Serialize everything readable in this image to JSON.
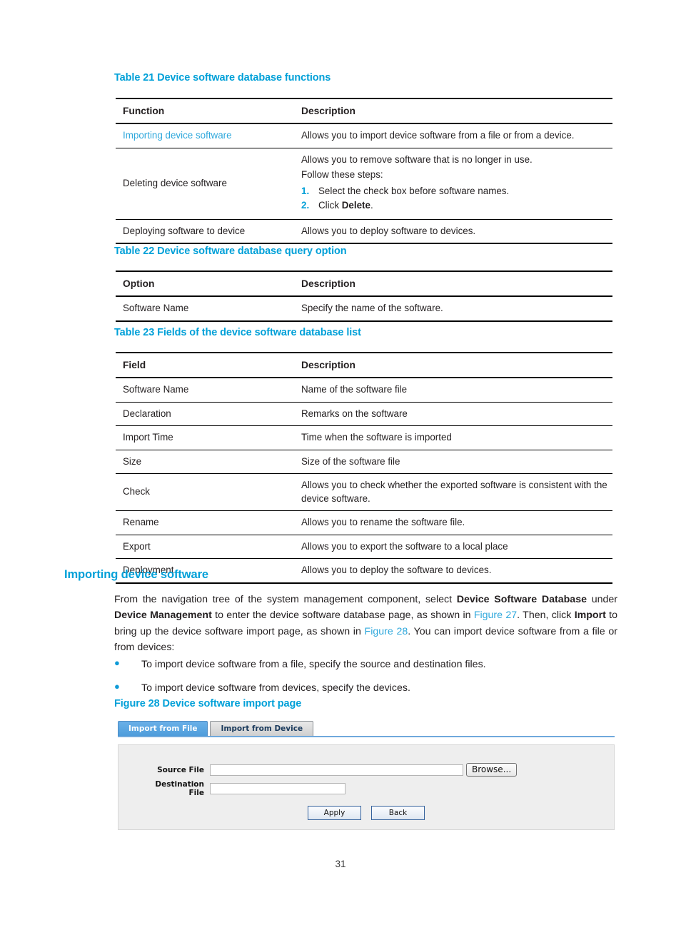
{
  "tables": [
    {
      "caption": "Table 21 Device software database functions",
      "headers": [
        "Function",
        "Description"
      ],
      "rows": [
        {
          "cell_a": "Importing device software",
          "cell_a_style": "link",
          "cell_b": "Allows you to import device software from a file or from a device."
        },
        {
          "cell_a": "Deleting device software",
          "cell_b_intro": "Allows you to remove software that is no longer in use.",
          "cell_b_steps_label": "Follow these steps:",
          "steps": [
            {
              "num": "1.",
              "text": "Select the check box before software names."
            },
            {
              "num": "2.",
              "text_pre": "Click ",
              "text_bold": "Delete",
              "text_post": "."
            }
          ]
        },
        {
          "cell_a": "Deploying software to device",
          "cell_b": "Allows you to deploy software to devices."
        }
      ]
    },
    {
      "caption": "Table 22 Device software database query option",
      "headers": [
        "Option",
        "Description"
      ],
      "rows": [
        {
          "cell_a": "Software Name",
          "cell_b": "Specify the name of the software."
        }
      ]
    },
    {
      "caption": "Table 23 Fields of the device software database list",
      "headers": [
        "Field",
        "Description"
      ],
      "rows": [
        {
          "cell_a": "Software Name",
          "cell_b": "Name of the software file"
        },
        {
          "cell_a": "Declaration",
          "cell_b": "Remarks on the software"
        },
        {
          "cell_a": "Import Time",
          "cell_b": "Time when the software is imported"
        },
        {
          "cell_a": "Size",
          "cell_b": "Size of the software file"
        },
        {
          "cell_a": "Check",
          "cell_b": "Allows you to check whether the exported software is consistent with the device software."
        },
        {
          "cell_a": "Rename",
          "cell_b": "Allows you to rename the software file."
        },
        {
          "cell_a": "Export",
          "cell_b": "Allows you to export the software to a local place"
        },
        {
          "cell_a": "Deployment",
          "cell_b": "Allows you to deploy the software to devices."
        }
      ]
    }
  ],
  "section": {
    "heading": "Importing device software",
    "paragraph": {
      "p1": "From the navigation tree of the system management component, select ",
      "b1": "Device Software Database",
      "p2": " under ",
      "b2": "Device Management",
      "p3": " to enter the device software database page, as shown in ",
      "ref1": "Figure 27",
      "p4": ". Then, click ",
      "b3": "Import",
      "p5": " to bring up the device software import page, as shown in ",
      "ref2": "Figure 28",
      "p6": ". You can import device software from a file or from devices:"
    },
    "bullets": [
      "To import device software from a file, specify the source and destination files.",
      "To import device software from devices, specify the devices."
    ]
  },
  "figure": {
    "caption": "Figure 28 Device software import page",
    "tabs": [
      {
        "label": "Import from File",
        "active": true
      },
      {
        "label": "Import from Device",
        "active": false
      }
    ],
    "fields": [
      {
        "label": "Source File",
        "value": "",
        "placeholder": ""
      },
      {
        "label": "Destination File",
        "value": "",
        "placeholder": ""
      }
    ],
    "browse_label": "Browse...",
    "buttons": [
      {
        "label": "Apply"
      },
      {
        "label": "Back"
      }
    ]
  },
  "footer": {
    "page_number": "31"
  },
  "colors": {
    "accent": "#00a0d8",
    "link": "#2fa8dc",
    "text": "#231f20",
    "tab_active_bg": "#4e9ddb",
    "tab_inactive_bg": "#cfcfcf",
    "panel_bg": "#eeeeee"
  }
}
